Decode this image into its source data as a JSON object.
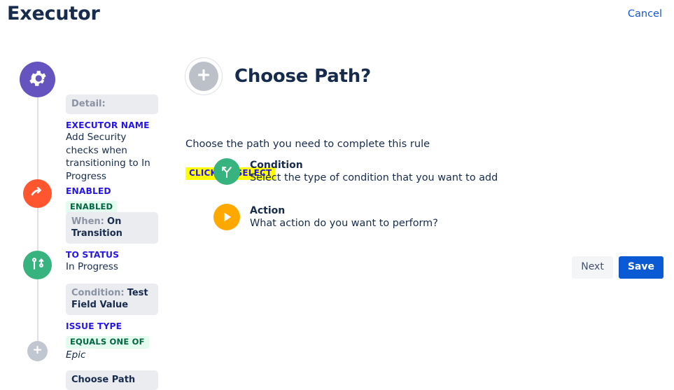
{
  "header": {
    "title": "Executor",
    "cancel_label": "Cancel",
    "cancel_color": "#1757d1"
  },
  "timeline": {
    "nodes": [
      {
        "name": "gear-node",
        "icon": "gear-icon",
        "color": "#6554c0"
      },
      {
        "name": "transition-node",
        "icon": "transition-arrow-icon",
        "color": "#ff5630"
      },
      {
        "name": "condition-node",
        "icon": "branch-icon",
        "color": "#36b37e"
      },
      {
        "name": "add-node",
        "icon": "plus-icon",
        "color": "#c1c7d0"
      }
    ],
    "detail": {
      "chip_label": "Detail:",
      "field_label": "EXECUTOR NAME",
      "field_value": "Add Security checks when transitioning to In Progress",
      "enabled_label": "ENABLED",
      "enabled_badge": "ENABLED"
    },
    "when": {
      "chip_key": "When:",
      "chip_value": "On Transition",
      "field_label": "TO STATUS",
      "field_value": "In Progress"
    },
    "condition": {
      "chip_key": "Condition:",
      "chip_value": "Test Field Value",
      "field_label": "ISSUE TYPE",
      "operator_badge": "EQUALS ONE OF",
      "field_value": "Epic"
    },
    "choose": {
      "chip_value": "Choose Path"
    }
  },
  "main": {
    "title": "Choose Path?",
    "subtitle": "Choose the path you need to complete this rule",
    "select_flag": "CLICK TO SELECT",
    "options": [
      {
        "title": "Condition",
        "desc": "Select the type of condition that you want to add",
        "icon": "fork-arrow-icon",
        "color": "#36b37e"
      },
      {
        "title": "Action",
        "desc": "What action do you want to perform?",
        "icon": "play-icon",
        "color": "#ffa800"
      }
    ],
    "buttons": {
      "next": "Next",
      "save": "Save",
      "save_color": "#0a5bd3"
    }
  }
}
